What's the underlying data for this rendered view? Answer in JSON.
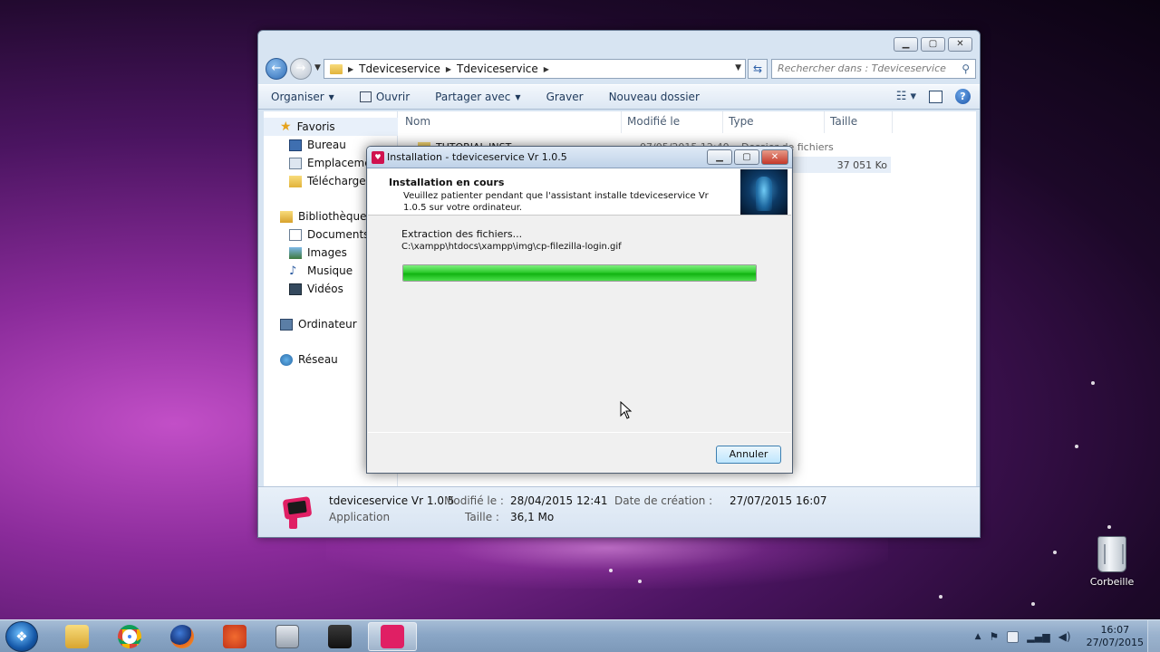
{
  "explorer": {
    "breadcrumb": [
      "Tdeviceservice",
      "Tdeviceservice"
    ],
    "search_placeholder": "Rechercher dans : Tdeviceservice",
    "toolbar": {
      "organiser": "Organiser",
      "ouvrir": "Ouvrir",
      "partager": "Partager avec",
      "graver": "Graver",
      "nouveau_dossier": "Nouveau dossier"
    },
    "nav": {
      "favoris": "Favoris",
      "bureau": "Bureau",
      "emplacements": "Emplacement",
      "telechargements": "Téléchargem",
      "bibliotheques": "Bibliothèques",
      "documents": "Documents",
      "images": "Images",
      "musique": "Musique",
      "videos": "Vidéos",
      "ordinateur": "Ordinateur",
      "reseau": "Réseau"
    },
    "columns": {
      "nom": "Nom",
      "modifie": "Modifié le",
      "type": "Type",
      "taille": "Taille"
    },
    "files": [
      {
        "name": "TUTORIAL INST",
        "date": "07/05/2015 12:40",
        "type": "Dossier de fichiers",
        "size": ""
      },
      {
        "name": "",
        "date": "",
        "type": "",
        "size": "37 051 Ko"
      }
    ],
    "details": {
      "name": "tdeviceservice Vr 1.0.5",
      "kind": "Application",
      "modified_label": "Modifié le :",
      "modified_value": "28/04/2015 12:41",
      "size_label": "Taille :",
      "size_value": "36,1 Mo",
      "created_label": "Date de création :",
      "created_value": "27/07/2015 16:07"
    }
  },
  "installer": {
    "title": "Installation - tdeviceservice Vr 1.0.5",
    "header_title": "Installation en cours",
    "header_desc": "Veuillez patienter pendant que l'assistant installe tdeviceservice Vr 1.0.5 sur votre ordinateur.",
    "status": "Extraction des fichiers...",
    "path": "C:\\xampp\\htdocs\\xampp\\img\\cp-filezilla-login.gif",
    "progress": 1.0,
    "cancel": "Annuler"
  },
  "desktop": {
    "recycle_bin": "Corbeille"
  },
  "taskbar": {
    "time": "16:07",
    "date": "27/07/2015"
  },
  "colors": {
    "progress_green": "#22c322",
    "title_bar": "#c9dbef",
    "close_red": "#c4382a"
  }
}
